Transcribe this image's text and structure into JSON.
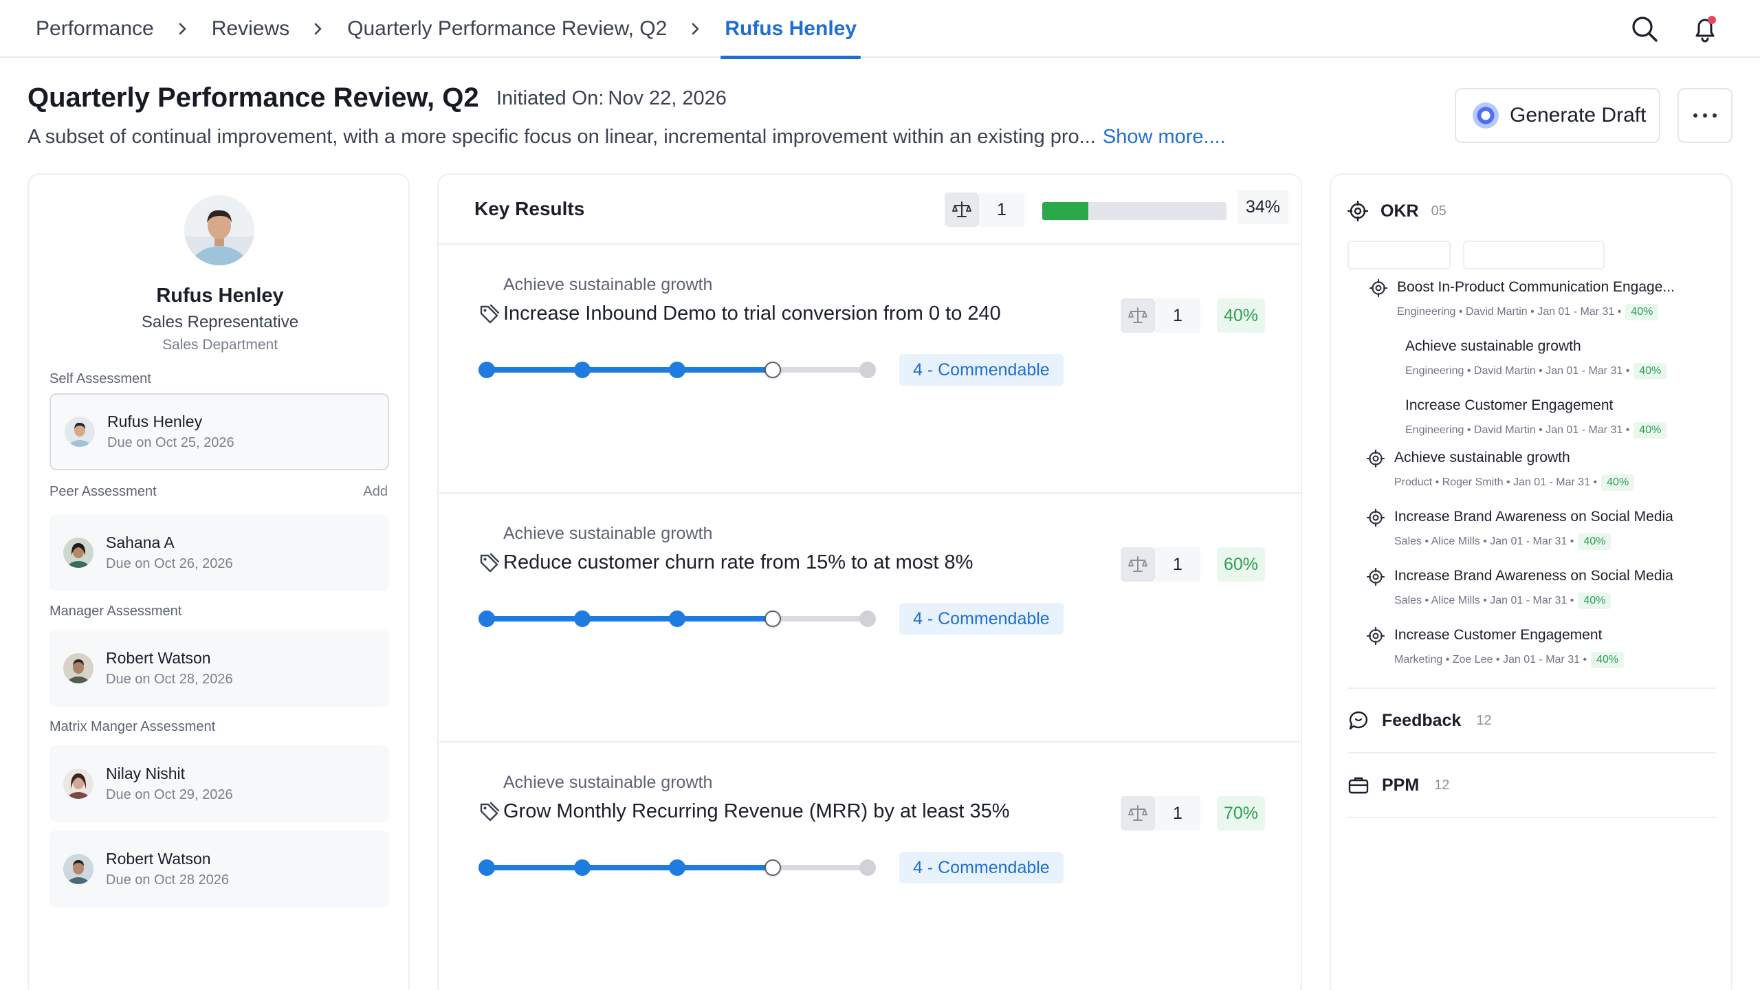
{
  "breadcrumb": {
    "items": [
      "Performance",
      "Reviews",
      "Quarterly Performance Review, Q2"
    ],
    "active": "Rufus Henley"
  },
  "header": {
    "title": "Quarterly Performance Review, Q2",
    "initiated_label": "Initiated On:",
    "initiated_date": "Nov 22, 2026",
    "description": "A subset of continual improvement, with a more specific focus on linear, incremental improvement within an existing pro...",
    "show_more": "Show more....",
    "generate_draft": "Generate Draft"
  },
  "employee": {
    "name": "Rufus Henley",
    "role": "Sales Representative",
    "department": "Sales Department"
  },
  "assessments": {
    "self_label": "Self Assessment",
    "self": {
      "name": "Rufus Henley",
      "due": "Due on Oct 25, 2026"
    },
    "peer_label": "Peer Assessment",
    "peer_add": "Add",
    "peer": {
      "name": "Sahana A",
      "due": "Due on Oct 26, 2026"
    },
    "manager_label": "Manager Assessment",
    "manager": {
      "name": "Robert Watson",
      "due": "Due on Oct 28, 2026"
    },
    "matrix_label": "Matrix Manger Assessment",
    "matrix": [
      {
        "name": "Nilay Nishit",
        "due": "Due on Oct 29, 2026"
      },
      {
        "name": "Robert Watson",
        "due": "Due on Oct 28 2026"
      }
    ]
  },
  "key_results": {
    "title": "Key Results",
    "weight": "1",
    "overall_progress": 0.25,
    "overall_pct": "34%",
    "items": [
      {
        "category": "Achieve sustainable growth",
        "name": "Increase Inbound Demo to trial conversion from 0 to 240",
        "weight": "1",
        "pct": "40%",
        "rating": "4 - Commendable",
        "rating_level": 4,
        "rating_max": 5
      },
      {
        "category": "Achieve sustainable growth",
        "name": "Reduce customer churn rate from 15% to at most 8%",
        "weight": "1",
        "pct": "60%",
        "rating": "4 - Commendable",
        "rating_level": 4,
        "rating_max": 5
      },
      {
        "category": "Achieve sustainable growth",
        "name": "Grow Monthly Recurring Revenue (MRR) by at least 35%",
        "weight": "1",
        "pct": "70%",
        "rating": "4 - Commendable",
        "rating_level": 4,
        "rating_max": 5
      }
    ]
  },
  "okr": {
    "title": "OKR",
    "count": "05",
    "items": [
      {
        "title": "Boost In-Product Communication Engage...",
        "meta": "Engineering • David Martin • Jan 01 - Mar 31 •",
        "pct": "40%",
        "icon": "target-icon"
      },
      {
        "title": "Achieve sustainable growth",
        "meta": "Engineering • David Martin • Jan 01 - Mar 31 •",
        "pct": "40%",
        "icon": ""
      },
      {
        "title": "Increase Customer Engagement",
        "meta": "Engineering • David Martin • Jan 01 - Mar 31 •",
        "pct": "40%",
        "icon": ""
      },
      {
        "title": "Achieve sustainable growth",
        "meta": "Product • Roger Smith • Jan 01 - Mar 31 •",
        "pct": "40%",
        "icon": "target-icon"
      },
      {
        "title": "Increase Brand Awareness on Social Media",
        "meta": "Sales • Alice Mills • Jan 01 - Mar 31 •",
        "pct": "40%",
        "icon": "target-icon"
      },
      {
        "title": "Increase Brand Awareness on Social Media",
        "meta": "Sales • Alice Mills • Jan 01 - Mar 31 •",
        "pct": "40%",
        "icon": "target-icon"
      },
      {
        "title": "Increase Customer Engagement",
        "meta": "Marketing • Zoe Lee • Jan 01 - Mar 31 •",
        "pct": "40%",
        "icon": "target-icon"
      }
    ]
  },
  "feedback": {
    "title": "Feedback",
    "count": "12"
  },
  "ppm": {
    "title": "PPM",
    "count": "12"
  },
  "colors": {
    "accent": "#1e6fd3",
    "progress_green": "#2aa84a",
    "pct_green": "#2f9e52",
    "slider_blue": "#1e7be0"
  }
}
